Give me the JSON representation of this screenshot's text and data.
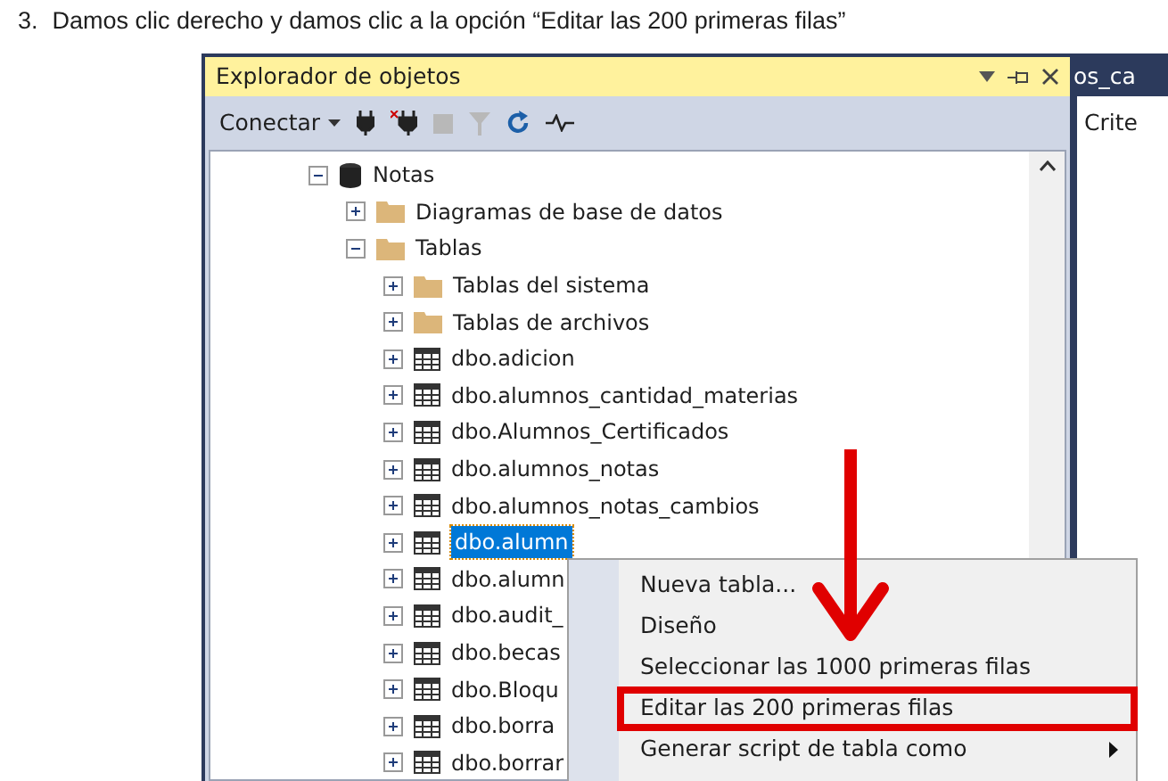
{
  "instruction": {
    "number": "3.",
    "text": "Damos clic derecho y damos clic a la opción “Editar las 200 primeras filas”"
  },
  "explorer": {
    "title": "Explorador de objetos",
    "toolbar": {
      "connect": "Conectar"
    },
    "tree": [
      {
        "label": "Notas",
        "kind": "database",
        "expanded": true,
        "selected": false,
        "children": [
          {
            "label": "Diagramas de base de datos",
            "kind": "folder",
            "expanded": false,
            "selected": false
          },
          {
            "label": "Tablas",
            "kind": "folder",
            "expanded": true,
            "selected": false,
            "children": [
              {
                "label": "Tablas del sistema",
                "kind": "folder",
                "expanded": false,
                "selected": false
              },
              {
                "label": "Tablas de archivos",
                "kind": "folder",
                "expanded": false,
                "selected": false
              },
              {
                "label": "dbo.adicion",
                "kind": "table",
                "expanded": false,
                "selected": false
              },
              {
                "label": "dbo.alumnos_cantidad_materias",
                "kind": "table",
                "expanded": false,
                "selected": false
              },
              {
                "label": "dbo.Alumnos_Certificados",
                "kind": "table",
                "expanded": false,
                "selected": false
              },
              {
                "label": "dbo.alumnos_notas",
                "kind": "table",
                "expanded": false,
                "selected": false
              },
              {
                "label": "dbo.alumnos_notas_cambios",
                "kind": "table",
                "expanded": false,
                "selected": false
              },
              {
                "label": "dbo.alumn",
                "kind": "table",
                "expanded": false,
                "selected": true
              },
              {
                "label": "dbo.alumn",
                "kind": "table",
                "expanded": false,
                "selected": false
              },
              {
                "label": "dbo.audit_",
                "kind": "table",
                "expanded": false,
                "selected": false
              },
              {
                "label": "dbo.becas",
                "kind": "table",
                "expanded": false,
                "selected": false
              },
              {
                "label": "dbo.Bloqu",
                "kind": "table",
                "expanded": false,
                "selected": false
              },
              {
                "label": "dbo.borra",
                "kind": "table",
                "expanded": false,
                "selected": false
              },
              {
                "label": "dbo.borrar",
                "kind": "table",
                "expanded": false,
                "selected": false
              }
            ]
          }
        ]
      }
    ]
  },
  "side_pane": {
    "tab": "os_ca",
    "label": "Crite"
  },
  "context_menu": [
    {
      "label": "Nueva tabla...",
      "submenu": false,
      "highlighted": false
    },
    {
      "label": "Diseño",
      "submenu": false,
      "highlighted": false
    },
    {
      "label": "Seleccionar las 1000 primeras filas",
      "submenu": false,
      "highlighted": false
    },
    {
      "label": "Editar las 200 primeras filas",
      "submenu": false,
      "highlighted": true
    },
    {
      "label": "Generar script de tabla como",
      "submenu": true,
      "highlighted": false
    }
  ]
}
